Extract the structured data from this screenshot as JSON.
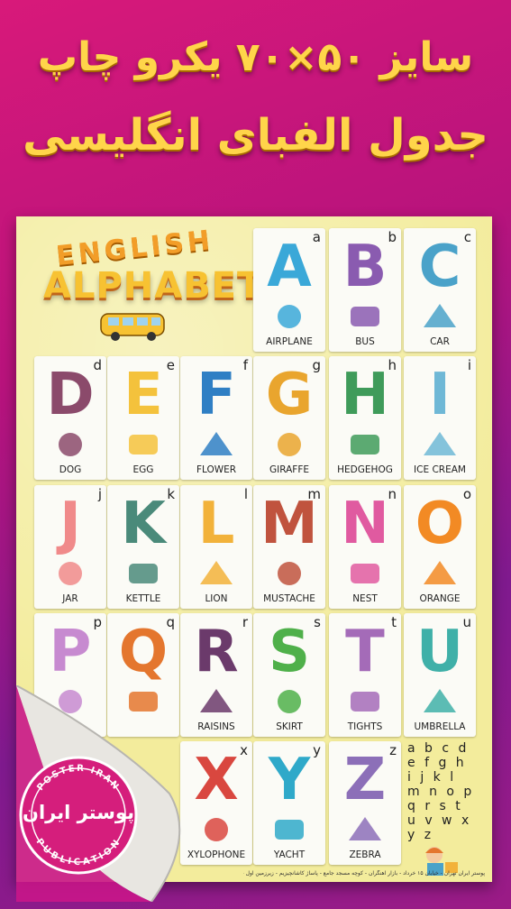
{
  "header": {
    "line1": "سایز ۵۰×۷۰ یکرو چاپ",
    "line2": "جدول الفبای انگلیسی"
  },
  "logo": {
    "word1": "ENGLISH",
    "word2": "ALPHABET"
  },
  "cards": [
    {
      "upper": "A",
      "lower": "a",
      "word": "AIRPLANE",
      "color": "#3aa8d8"
    },
    {
      "upper": "B",
      "lower": "b",
      "word": "BUS",
      "color": "#8a5bb0"
    },
    {
      "upper": "C",
      "lower": "c",
      "word": "CAR",
      "color": "#4aa2c9"
    },
    {
      "upper": "D",
      "lower": "d",
      "word": "DOG",
      "color": "#8b4a6b"
    },
    {
      "upper": "E",
      "lower": "e",
      "word": "EGG",
      "color": "#f4c23c"
    },
    {
      "upper": "F",
      "lower": "f",
      "word": "FLOWER",
      "color": "#2f7fc4"
    },
    {
      "upper": "G",
      "lower": "g",
      "word": "GIRAFFE",
      "color": "#e9a52e"
    },
    {
      "upper": "H",
      "lower": "h",
      "word": "HEDGEHOG",
      "color": "#3f9b5a"
    },
    {
      "upper": "I",
      "lower": "i",
      "word": "ICE CREAM",
      "color": "#6fb8d6"
    },
    {
      "upper": "J",
      "lower": "j",
      "word": "JAR",
      "color": "#f08a8a"
    },
    {
      "upper": "K",
      "lower": "k",
      "word": "KETTLE",
      "color": "#4a8a7a"
    },
    {
      "upper": "L",
      "lower": "l",
      "word": "LION",
      "color": "#f2b23a"
    },
    {
      "upper": "M",
      "lower": "m",
      "word": "MUSTACHE",
      "color": "#c0533e"
    },
    {
      "upper": "N",
      "lower": "n",
      "word": "NEST",
      "color": "#e05aa0"
    },
    {
      "upper": "O",
      "lower": "o",
      "word": "ORANGE",
      "color": "#f28a24"
    },
    {
      "upper": "P",
      "lower": "p",
      "word": "",
      "color": "#c78ad0"
    },
    {
      "upper": "Q",
      "lower": "q",
      "word": "",
      "color": "#e4762e"
    },
    {
      "upper": "R",
      "lower": "r",
      "word": "RAISINS",
      "color": "#6b3a6b"
    },
    {
      "upper": "S",
      "lower": "s",
      "word": "SKIRT",
      "color": "#4fb04a"
    },
    {
      "upper": "T",
      "lower": "t",
      "word": "TIGHTS",
      "color": "#a46bb8"
    },
    {
      "upper": "U",
      "lower": "u",
      "word": "UMBRELLA",
      "color": "#3fb0a8"
    },
    {
      "upper": "X",
      "lower": "x",
      "word": "XYLOPHONE",
      "color": "#d9473f"
    },
    {
      "upper": "Y",
      "lower": "y",
      "word": "YACHT",
      "color": "#2fa9c9"
    },
    {
      "upper": "Z",
      "lower": "z",
      "word": "ZEBRA",
      "color": "#8c6fb8"
    }
  ],
  "small_letters": [
    "a b c d",
    "e f g h",
    "i j k l",
    "m n o p",
    "q r s t",
    "u v w x",
    "y z"
  ],
  "footer_text": "پوستر ایران   تهران - خیابان ۱۵ خرداد - بازار آهنگران - کوچه مسجد جامع - پاساژ کاشانچیزیم - زیرزمین اول - پلاک ۷۴  تلفن: ۵۵۶۰۱۱۸۹۵",
  "seal": {
    "center": "پوستر ایران",
    "top": "POSTER IRAN",
    "bottom": "PUBLICATION"
  }
}
